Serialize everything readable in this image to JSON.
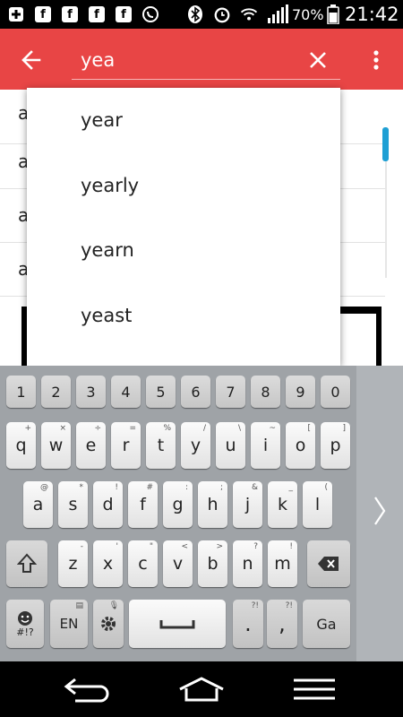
{
  "status_bar": {
    "battery": "70%",
    "time": "21:42",
    "icons": [
      "plus-notification-icon",
      "facebook-icon",
      "facebook-icon",
      "facebook-icon",
      "whatsapp-icon",
      "bluetooth-icon",
      "alarm-icon",
      "wifi-icon",
      "signal-icon",
      "battery-icon"
    ]
  },
  "toolbar": {
    "search_value": "yea",
    "color": "#e84545"
  },
  "list": {
    "rows": [
      "a",
      "a",
      "a",
      "a"
    ]
  },
  "suggestions": [
    "year",
    "yearly",
    "yearn",
    "yeast"
  ],
  "keyboard": {
    "number_row": [
      "1",
      "2",
      "3",
      "4",
      "5",
      "6",
      "7",
      "8",
      "9",
      "0"
    ],
    "row1": [
      {
        "main": "q",
        "sub": "+"
      },
      {
        "main": "w",
        "sub": "×"
      },
      {
        "main": "e",
        "sub": "÷"
      },
      {
        "main": "r",
        "sub": "="
      },
      {
        "main": "t",
        "sub": "%"
      },
      {
        "main": "y",
        "sub": "/"
      },
      {
        "main": "u",
        "sub": "\\"
      },
      {
        "main": "i",
        "sub": "~"
      },
      {
        "main": "o",
        "sub": "["
      },
      {
        "main": "p",
        "sub": "]"
      }
    ],
    "row2": [
      {
        "main": "a",
        "sub": "@"
      },
      {
        "main": "s",
        "sub": "*"
      },
      {
        "main": "d",
        "sub": "!"
      },
      {
        "main": "f",
        "sub": "#"
      },
      {
        "main": "g",
        "sub": ":"
      },
      {
        "main": "h",
        "sub": ";"
      },
      {
        "main": "j",
        "sub": "&"
      },
      {
        "main": "k",
        "sub": "_"
      },
      {
        "main": "l",
        "sub": "("
      }
    ],
    "row3": [
      {
        "main": "z",
        "sub": "-"
      },
      {
        "main": "x",
        "sub": "'"
      },
      {
        "main": "c",
        "sub": "\""
      },
      {
        "main": "v",
        "sub": "<"
      },
      {
        "main": "b",
        "sub": ">"
      },
      {
        "main": "n",
        "sub": "?"
      },
      {
        "main": "m",
        "sub": "!"
      }
    ],
    "bottom": {
      "symbols_label": "#!?",
      "lang_label": "EN",
      "period_label": ".",
      "comma_label": ",",
      "go_label": "Ga"
    }
  }
}
